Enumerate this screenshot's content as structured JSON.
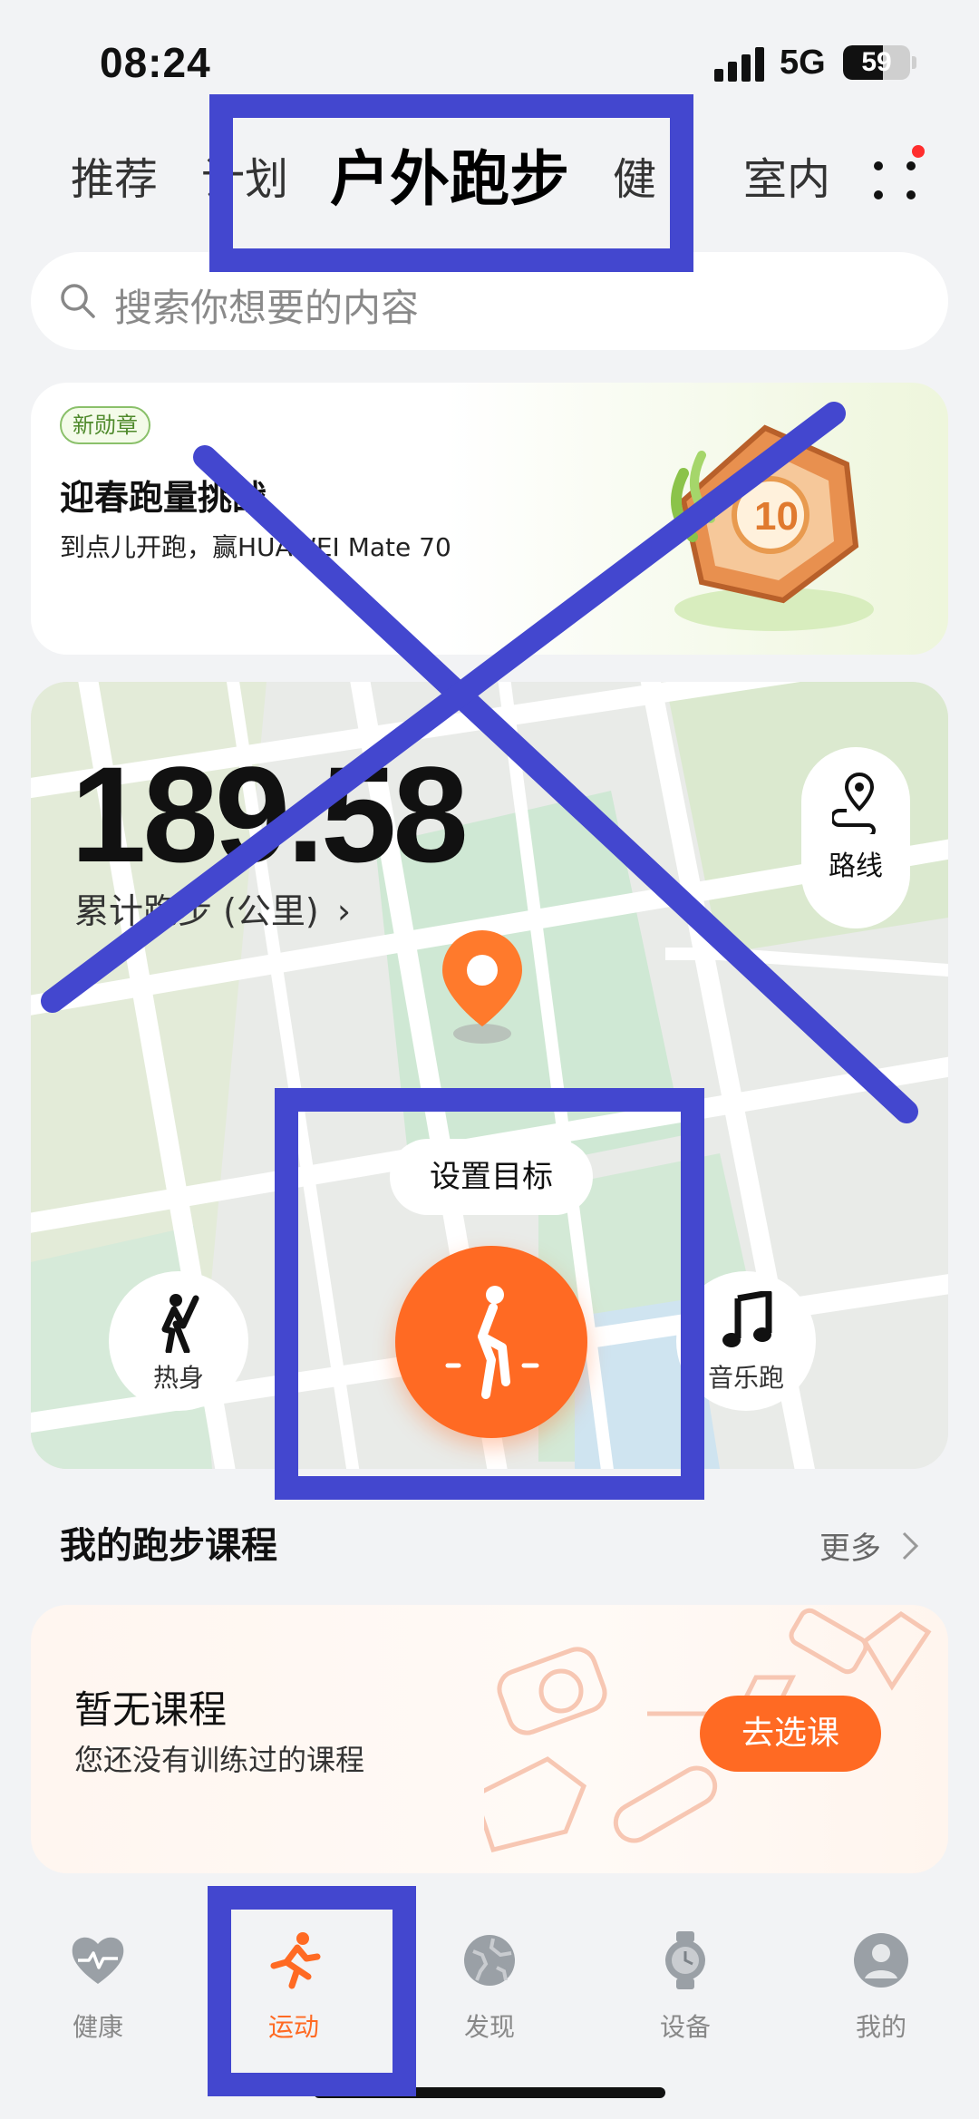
{
  "status_bar": {
    "time": "08:24",
    "network": "5G",
    "battery": "59",
    "battery_level": 0.59
  },
  "tabs": [
    {
      "label": "推荐"
    },
    {
      "label": "计划"
    },
    {
      "label": "户外跑步"
    },
    {
      "label": "健"
    },
    {
      "label": "室内"
    }
  ],
  "search": {
    "placeholder": "搜索你想要的内容"
  },
  "promo": {
    "badge": "新勋章",
    "title": "迎春跑量挑战",
    "subtitle": "到点儿开跑，赢HUAWEI Mate 70"
  },
  "map_card": {
    "distance": "189.58",
    "distance_label": "累计跑步 (公里)",
    "route_label": "路线",
    "goal_label": "设置目标",
    "warmup_label": "热身",
    "music_label": "音乐跑"
  },
  "courses": {
    "title": "我的跑步课程",
    "more": "更多",
    "empty_title": "暂无课程",
    "empty_subtitle": "您还没有训练过的课程",
    "button": "去选课"
  },
  "bottom_nav": [
    {
      "label": "健康"
    },
    {
      "label": "运动"
    },
    {
      "label": "发现"
    },
    {
      "label": "设备"
    },
    {
      "label": "我的"
    }
  ],
  "colors": {
    "accent": "#ff6a23",
    "annotation": "#4347cf",
    "badge_green": "#4f8a2c"
  }
}
